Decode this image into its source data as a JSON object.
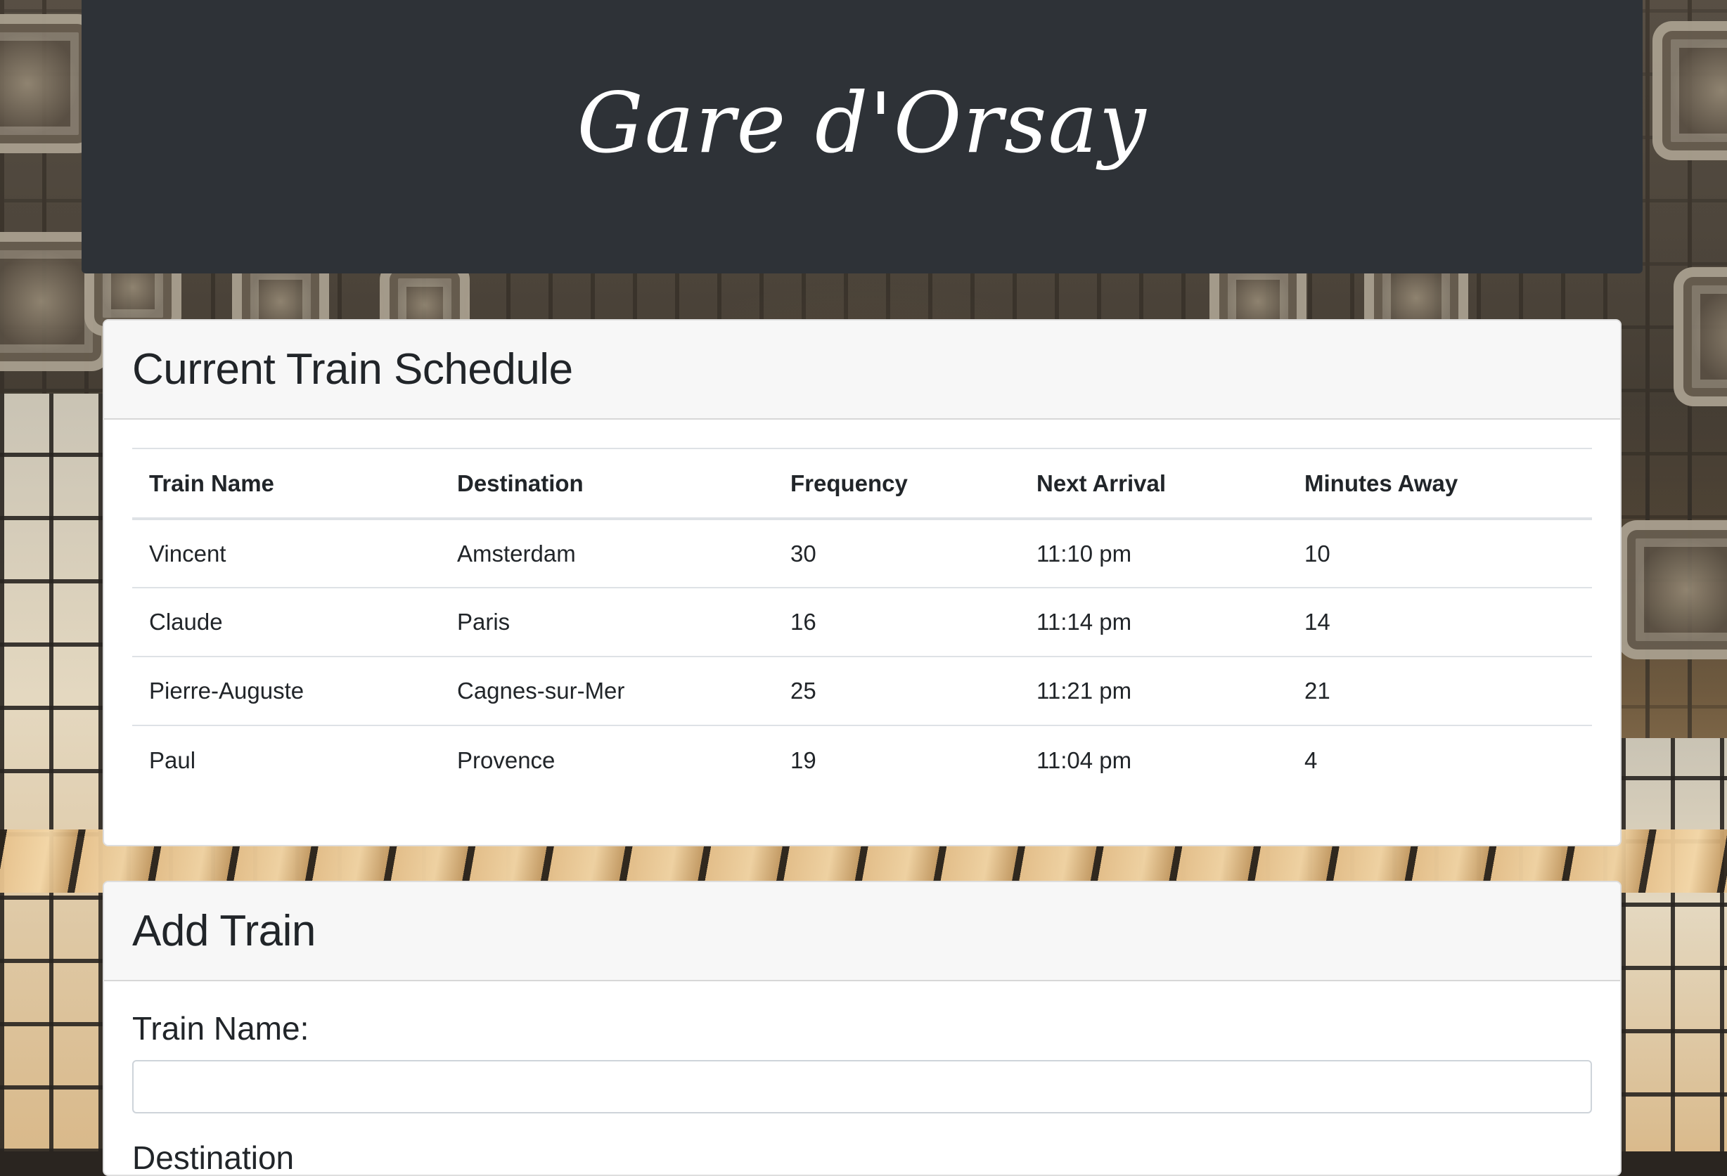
{
  "header": {
    "title": "Gare d'Orsay"
  },
  "schedule": {
    "title": "Current Train Schedule",
    "columns": [
      "Train Name",
      "Destination",
      "Frequency",
      "Next Arrival",
      "Minutes Away"
    ],
    "rows": [
      [
        "Vincent",
        "Amsterdam",
        "30",
        "11:10 pm",
        "10"
      ],
      [
        "Claude",
        "Paris",
        "16",
        "11:14 pm",
        "14"
      ],
      [
        "Pierre-Auguste",
        "Cagnes-sur-Mer",
        "25",
        "11:21 pm",
        "21"
      ],
      [
        "Paul",
        "Provence",
        "19",
        "11:04 pm",
        "4"
      ]
    ]
  },
  "add_train": {
    "title": "Add Train",
    "train_name_label": "Train Name:",
    "train_name_value": "",
    "destination_label": "Destination"
  },
  "colors": {
    "header_bg": "#2e3237",
    "card_header_bg": "#f7f7f7",
    "text": "#212529"
  }
}
